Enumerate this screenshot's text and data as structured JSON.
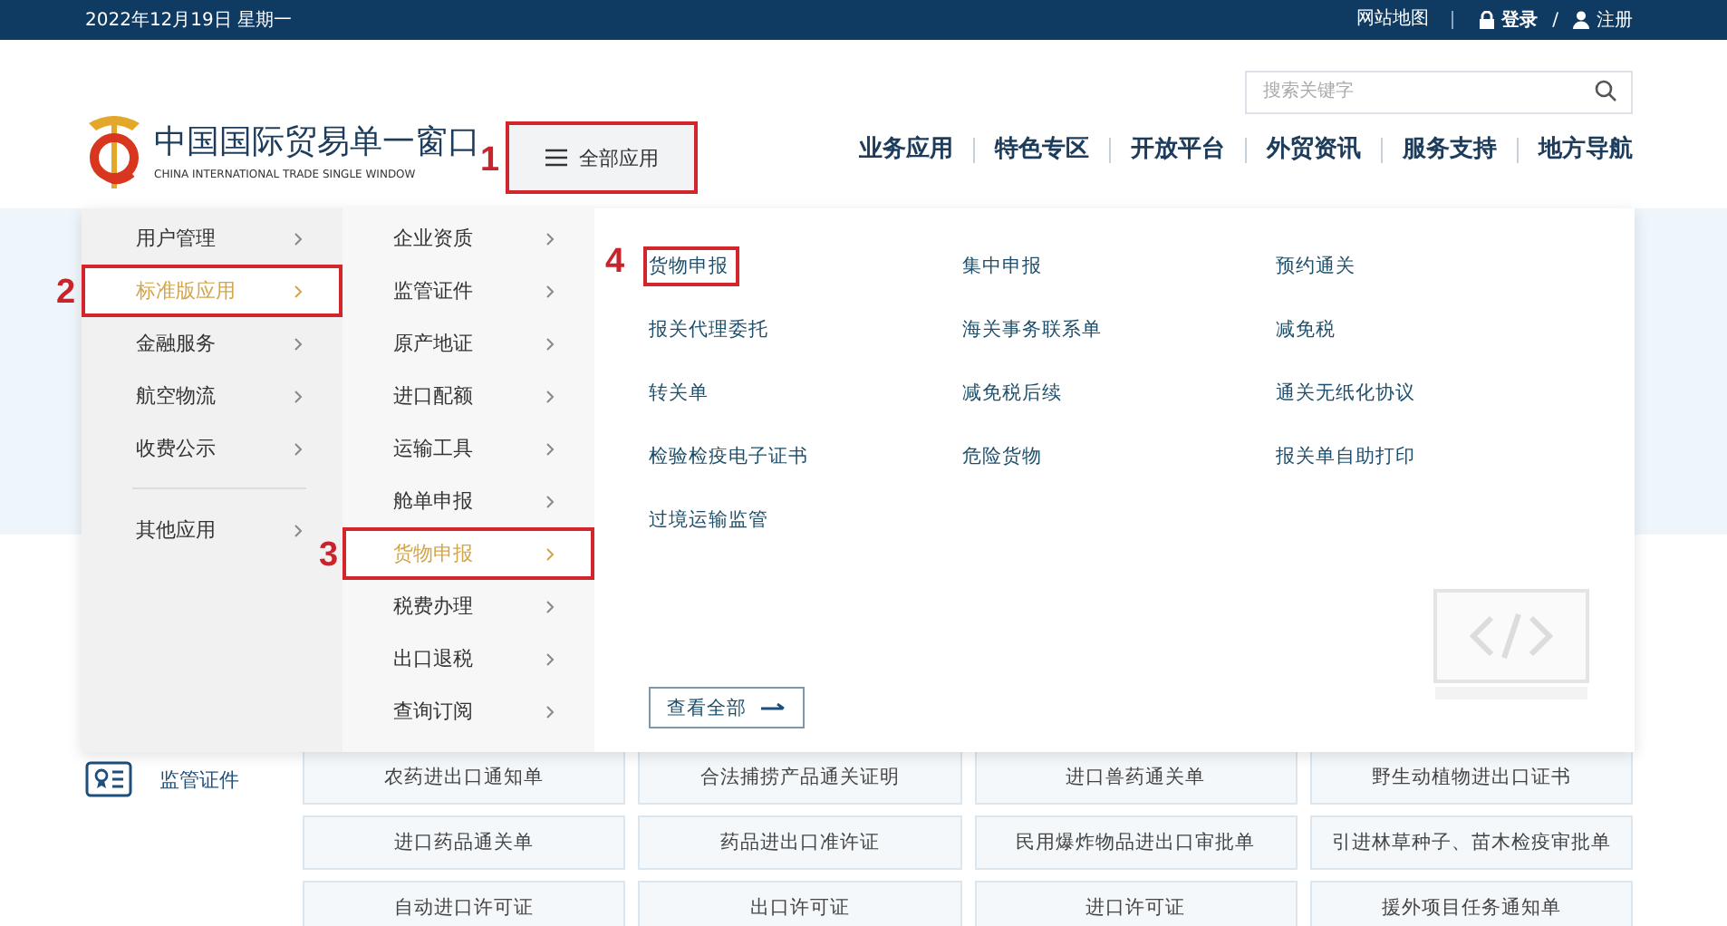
{
  "top_bar": {
    "date": "2022年12月19日 星期一",
    "sitemap": "网站地图",
    "login": "登录",
    "separator": "/",
    "register": "注册"
  },
  "header": {
    "logo": {
      "title": "中国国际贸易单一窗口",
      "subtitle": "CHINA INTERNATIONAL TRADE SINGLE WINDOW"
    },
    "all_apps_button": {
      "label": "全部应用",
      "callout": "1"
    },
    "search": {
      "placeholder": "搜索关键字"
    },
    "nav": [
      "业务应用",
      "特色专区",
      "开放平台",
      "外贸资讯",
      "服务支持",
      "地方导航"
    ]
  },
  "menu": {
    "category_groups": [
      [
        {
          "label": "用户管理",
          "selected": false
        },
        {
          "label": "标准版应用",
          "selected": true,
          "callout": "2"
        },
        {
          "label": "金融服务",
          "selected": false
        },
        {
          "label": "航空物流",
          "selected": false
        },
        {
          "label": "收费公示",
          "selected": false
        }
      ],
      [
        {
          "label": "其他应用",
          "selected": false
        }
      ]
    ],
    "subcategories": [
      {
        "label": "企业资质",
        "selected": false
      },
      {
        "label": "监管证件",
        "selected": false
      },
      {
        "label": "原产地证",
        "selected": false
      },
      {
        "label": "进口配额",
        "selected": false
      },
      {
        "label": "运输工具",
        "selected": false
      },
      {
        "label": "舱单申报",
        "selected": false
      },
      {
        "label": "货物申报",
        "selected": true,
        "callout": "3"
      },
      {
        "label": "税费办理",
        "selected": false
      },
      {
        "label": "出口退税",
        "selected": false
      },
      {
        "label": "查询订阅",
        "selected": false
      }
    ],
    "apps": [
      {
        "label": "货物申报",
        "callout": "4"
      },
      {
        "label": "集中申报"
      },
      {
        "label": "预约通关"
      },
      {
        "label": "报关代理委托"
      },
      {
        "label": "海关事务联系单"
      },
      {
        "label": "减免税"
      },
      {
        "label": "转关单"
      },
      {
        "label": "减免税后续"
      },
      {
        "label": "通关无纸化协议"
      },
      {
        "label": "检验检疫电子证书"
      },
      {
        "label": "危险货物"
      },
      {
        "label": "报关单自助打印"
      },
      {
        "label": "过境运输监管"
      }
    ],
    "view_all": "查看全部"
  },
  "section": {
    "title": "监管证件",
    "items": [
      "农药进出口通知单",
      "合法捕捞产品通关证明",
      "进口兽药通关单",
      "野生动植物进出口证书",
      "进口药品通关单",
      "药品进出口准许证",
      "民用爆炸物品进出口审批单",
      "引进林草种子、苗木检疫审批单",
      "自动进口许可证",
      "出口许可证",
      "进口许可证",
      "援外项目任务通知单"
    ]
  }
}
